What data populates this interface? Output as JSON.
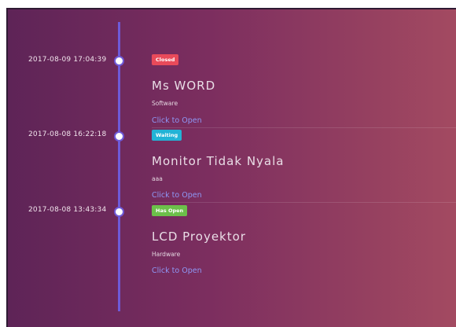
{
  "tickets": [
    {
      "timestamp": "2017-08-09 17:04:39",
      "status": "Closed",
      "status_color": "#e84a5a",
      "title": "Ms WORD",
      "category": "Software",
      "link": "Click to Open"
    },
    {
      "timestamp": "2017-08-08 16:22:18",
      "status": "Waiting",
      "status_color": "#22b3d6",
      "title": "Monitor Tidak Nyala",
      "category": "aaa",
      "link": "Click to Open"
    },
    {
      "timestamp": "2017-08-08 13:43:34",
      "status": "Has Open",
      "status_color": "#6cc04a",
      "title": "LCD Proyektor",
      "category": "Hardware",
      "link": "Click to Open"
    }
  ],
  "colors": {
    "timeline": "#6e5ad8",
    "link": "#8e97f5"
  }
}
